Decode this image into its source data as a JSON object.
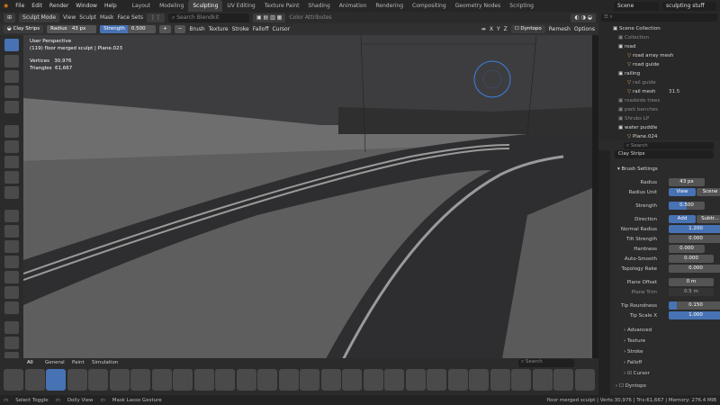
{
  "topbar": {
    "menus": [
      "File",
      "Edit",
      "Render",
      "Window",
      "Help"
    ],
    "workspaces": [
      "Layout",
      "Modeling",
      "Sculpting",
      "UV Editing",
      "Texture Paint",
      "Shading",
      "Animation",
      "Rendering",
      "Compositing",
      "Geometry Nodes",
      "Scripting"
    ],
    "active_workspace": "Sculpting",
    "scene": "Scene",
    "view_layer": "sculpting stuff"
  },
  "header": {
    "mode": "Sculpt Mode",
    "menus": [
      "View",
      "Sculpt",
      "Mask",
      "Face Sets"
    ],
    "search_placeholder": "Search Blendkit",
    "color_attributes": "Color Attributes",
    "dyntopo": "Dyntopo",
    "remesh": "Remesh",
    "options": "Options"
  },
  "toolheader": {
    "brush": "Clay Strips",
    "radius_label": "Radius",
    "radius": "43 px",
    "strength_label": "Strength",
    "strength": "0.500",
    "menus": [
      "Brush",
      "Texture",
      "Stroke",
      "Falloff",
      "Cursor"
    ],
    "axes": [
      "X",
      "Y",
      "Z"
    ]
  },
  "viewport": {
    "view": "User Perspective",
    "object": "(119) floor merged sculpt | Plane.023",
    "vertices_label": "Vertices",
    "vertices": "30,976",
    "triangles_label": "Triangles",
    "triangles": "61,667"
  },
  "brushbar": {
    "tabs": [
      "All",
      "General",
      "Paint",
      "Simulation"
    ],
    "search_placeholder": "Search",
    "brush_count": 28
  },
  "outliner": {
    "search_placeholder": "Search",
    "root": "Scene Collection",
    "items": [
      "Collection",
      "road",
      "road array mesh",
      "road guide",
      "railing",
      "rail guide",
      "rail mesh",
      "roadside trees",
      "park benches",
      "Shrubs LP",
      "water puddle",
      "Plane.024"
    ],
    "badge": "31.5"
  },
  "properties": {
    "active_brush": "Clay Strips",
    "section": "Brush Settings",
    "radius_label": "Radius",
    "radius": "43 px",
    "radius_unit_label": "Radius Unit",
    "radius_unit_view": "View",
    "radius_unit_scene": "Scene",
    "strength_label": "Strength",
    "strength": "0.500",
    "direction_label": "Direction",
    "direction_add": "Add",
    "direction_sub": "Subtr...",
    "normal_radius_label": "Normal Radius",
    "normal_radius": "1.200",
    "tilt_strength_label": "Tilt Strength",
    "tilt_strength": "0.000",
    "hardness_label": "Hardness",
    "hardness": "0.000",
    "auto_smooth_label": "Auto-Smooth",
    "auto_smooth": "0.000",
    "topology_rake_label": "Topology Rake",
    "topology_rake": "0.000",
    "plane_offset_label": "Plane Offset",
    "plane_offset": "0 m",
    "plane_trim_label": "Plane Trim",
    "plane_trim": "0.5 m",
    "tip_roundness_label": "Tip Roundness",
    "tip_roundness": "0.150",
    "tip_scale_label": "Tip Scale X",
    "tip_scale": "1.000",
    "subpanels": [
      "Advanced",
      "Texture",
      "Stroke",
      "Falloff",
      "Cursor",
      "Dyntopo"
    ]
  },
  "statusbar": {
    "select": "Select Toggle",
    "dolly": "Dolly View",
    "mask": "Mask Lasso Gesture",
    "stats": "floor merged sculpt | Verts:30,976 | Tris:61,667 | Memory: 276.4 MiB"
  },
  "colors": {
    "accent": "#4772b3",
    "bg": "#1d1d1d",
    "panel": "#2b2b2b"
  }
}
